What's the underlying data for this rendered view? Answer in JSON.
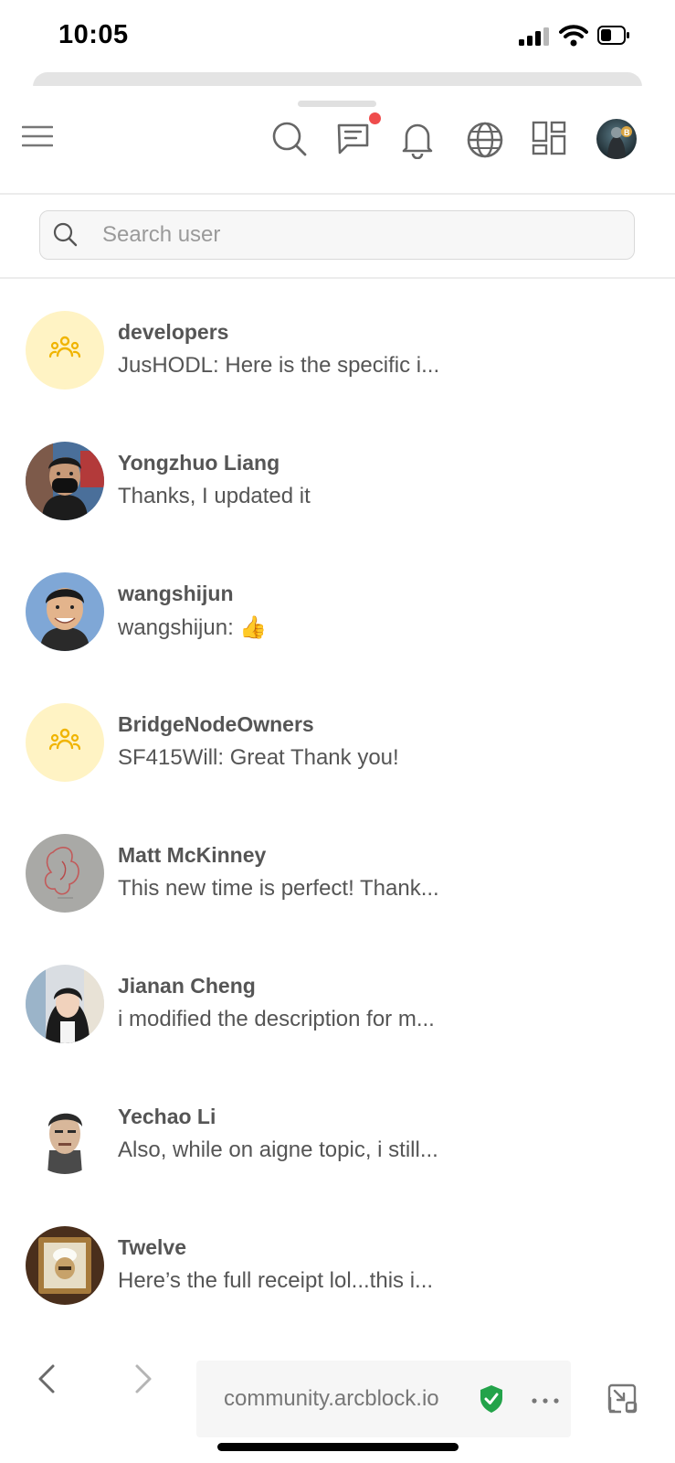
{
  "status_bar": {
    "time": "10:05"
  },
  "header": {
    "icons": [
      "menu-icon",
      "search-icon",
      "chat-icon",
      "bell-icon",
      "globe-icon",
      "apps-grid-icon"
    ],
    "has_unread_messages": true
  },
  "search": {
    "placeholder": "Search user",
    "value": ""
  },
  "conversations": [
    {
      "name": "developers",
      "preview": "JusHODL: Here is the specific i...",
      "avatar": "group-icon"
    },
    {
      "name": "Yongzhuo Liang",
      "preview": "Thanks, I updated it",
      "avatar": "photo"
    },
    {
      "name": "wangshijun",
      "preview": "wangshijun: ",
      "emoji": "👍",
      "avatar": "photo"
    },
    {
      "name": "BridgeNodeOwners",
      "preview": "SF415Will: Great Thank you!",
      "avatar": "group-icon"
    },
    {
      "name": "Matt McKinney",
      "preview": "This new time is perfect! Thank...",
      "avatar": "photo"
    },
    {
      "name": "Jianan Cheng",
      "preview": "i modified the description for m...",
      "avatar": "photo"
    },
    {
      "name": "Yechao Li",
      "preview": "Also, while on aigne topic, i still...",
      "avatar": "photo"
    },
    {
      "name": "Twelve",
      "preview": "Here’s the full receipt lol...this i...",
      "avatar": "photo"
    }
  ],
  "browser": {
    "url": "community.arcblock.io"
  },
  "colors": {
    "accent_badge": "#ef4c4c",
    "group_avatar_bg": "#fff3c4",
    "group_icon": "#f0b400",
    "secure_shield": "#23a34a"
  }
}
